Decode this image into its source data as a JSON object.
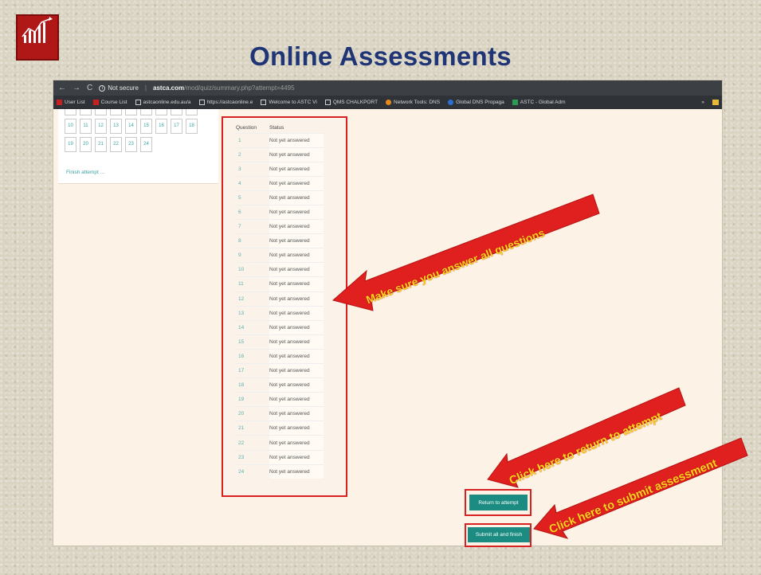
{
  "slide": {
    "title": "Online Assessments"
  },
  "browser": {
    "nav": {
      "back": "←",
      "forward": "→",
      "reload": "C"
    },
    "security_label": "Not secure",
    "url_host": "astca.com",
    "url_path": "/mod/quiz/summary.php?attempt=4495",
    "bookmarks": [
      {
        "label": "User List",
        "icon": "red-square-icon"
      },
      {
        "label": "Course List",
        "icon": "red-square-icon"
      },
      {
        "label": "astcaonline.edu.au/a",
        "icon": "page-icon"
      },
      {
        "label": "https://astcaonline.e",
        "icon": "page-icon"
      },
      {
        "label": "Welcome to ASTC Vi",
        "icon": "page-icon"
      },
      {
        "label": "QMS CHALKPORT",
        "icon": "page-icon"
      },
      {
        "label": "Network Tools: DNS",
        "icon": "orange-globe-icon"
      },
      {
        "label": "Global DNS Propaga",
        "icon": "blue-globe-icon"
      },
      {
        "label": "ASTC - Global Adm",
        "icon": "green-square-icon"
      }
    ],
    "bookmarks_more": "»"
  },
  "quiz_nav": {
    "rows": [
      [
        "",
        "",
        "",
        "",
        "",
        "",
        "",
        "",
        ""
      ],
      [
        "10",
        "11",
        "12",
        "13",
        "14",
        "15",
        "16",
        "17",
        "18"
      ],
      [
        "19",
        "20",
        "21",
        "22",
        "23",
        "24"
      ]
    ],
    "finish_link": "Finish attempt ..."
  },
  "summary": {
    "header_question": "Question",
    "header_status": "Status",
    "rows": [
      {
        "q": "1",
        "status": "Not yet answered"
      },
      {
        "q": "2",
        "status": "Not yet answered"
      },
      {
        "q": "3",
        "status": "Not yet answered"
      },
      {
        "q": "4",
        "status": "Not yet answered"
      },
      {
        "q": "5",
        "status": "Not yet answered"
      },
      {
        "q": "6",
        "status": "Not yet answered"
      },
      {
        "q": "7",
        "status": "Not yet answered"
      },
      {
        "q": "8",
        "status": "Not yet answered"
      },
      {
        "q": "9",
        "status": "Not yet answered"
      },
      {
        "q": "10",
        "status": "Not yet answered"
      },
      {
        "q": "11",
        "status": "Not yet answered"
      },
      {
        "q": "12",
        "status": "Not yet answered"
      },
      {
        "q": "13",
        "status": "Not yet answered"
      },
      {
        "q": "14",
        "status": "Not yet answered"
      },
      {
        "q": "15",
        "status": "Not yet answered"
      },
      {
        "q": "16",
        "status": "Not yet answered"
      },
      {
        "q": "17",
        "status": "Not yet answered"
      },
      {
        "q": "18",
        "status": "Not yet answered"
      },
      {
        "q": "19",
        "status": "Not yet answered"
      },
      {
        "q": "20",
        "status": "Not yet answered"
      },
      {
        "q": "21",
        "status": "Not yet answered"
      },
      {
        "q": "22",
        "status": "Not yet answered"
      },
      {
        "q": "23",
        "status": "Not yet answered"
      },
      {
        "q": "24",
        "status": "Not yet answered"
      }
    ]
  },
  "buttons": {
    "return": "Return to attempt",
    "submit": "Submit all and finish"
  },
  "annotations": {
    "answer_all": "Make sure you answer all questions",
    "return": "Click here to return to attempt",
    "submit": "Click here to submit assessment"
  },
  "colors": {
    "title": "#1f3575",
    "arrow_fill": "#e01f1f",
    "arrow_text": "#ffd21e",
    "button": "#1c8c82",
    "highlight_box": "#d82222"
  }
}
